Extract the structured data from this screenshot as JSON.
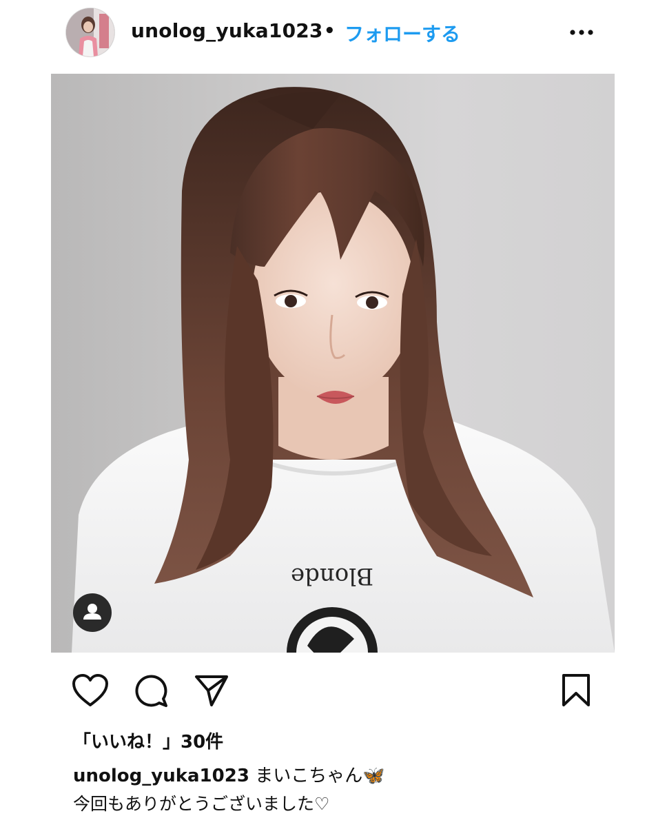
{
  "header": {
    "username": "unolog_yuka1023",
    "separator": "•",
    "follow_label": "フォローする",
    "avatar_icon": "profile-avatar",
    "more_icon": "more-horizontal-icon"
  },
  "post": {
    "image_icon": "post-photo",
    "tag_icon": "user-tag-icon"
  },
  "actions": {
    "like_icon": "heart-icon",
    "comment_icon": "comment-bubble-icon",
    "share_icon": "paper-plane-icon",
    "save_icon": "bookmark-icon"
  },
  "likes": {
    "text": "「いいね！」30件"
  },
  "caption": {
    "username": "unolog_yuka1023",
    "text": " まいこちゃん🦋",
    "line2": "今回もありがとうございました♡"
  },
  "colors": {
    "follow_blue": "#1d9bf0",
    "text": "#111111",
    "background": "#ffffff"
  }
}
